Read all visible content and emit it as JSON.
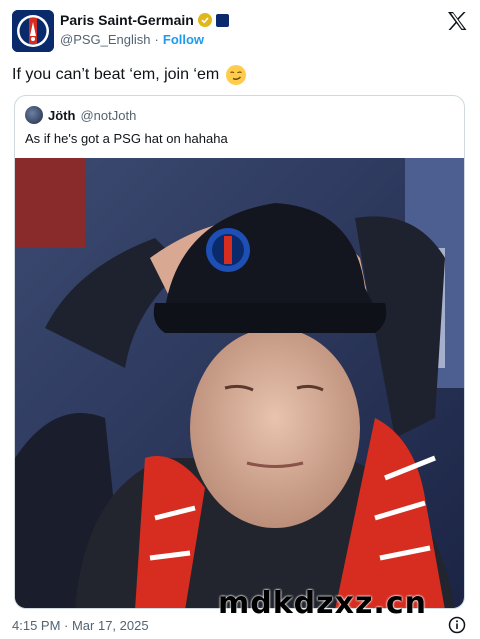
{
  "author": {
    "display_name": "Paris Saint-Germain",
    "handle": "@PSG_English",
    "separator": "·",
    "follow_label": "Follow",
    "avatar_icon": "psg-crest-icon",
    "verified_icon": "gold-verified-badge-icon",
    "affiliate_icon": "affiliate-badge-icon"
  },
  "tweet": {
    "text": "If you can’t beat ‘em, join ‘em",
    "emoji_icon": "smirking-face-emoji-icon",
    "timestamp": "4:15 PM · Mar 17, 2025"
  },
  "quoted_tweet": {
    "display_name": "Jöth",
    "handle": "@notJoth",
    "text": "As if he's got a PSG hat on hahaha",
    "media": "photo of a fan in a PSG cap with hands on head wearing a red scarf"
  },
  "watermark": "mdkdzxz.cn",
  "colors": {
    "link": "#1d9bf0",
    "secondary_text": "#536471",
    "border": "#cfd9de",
    "psg_navy": "#0a2a6b",
    "scarf_red": "#d62d20"
  }
}
